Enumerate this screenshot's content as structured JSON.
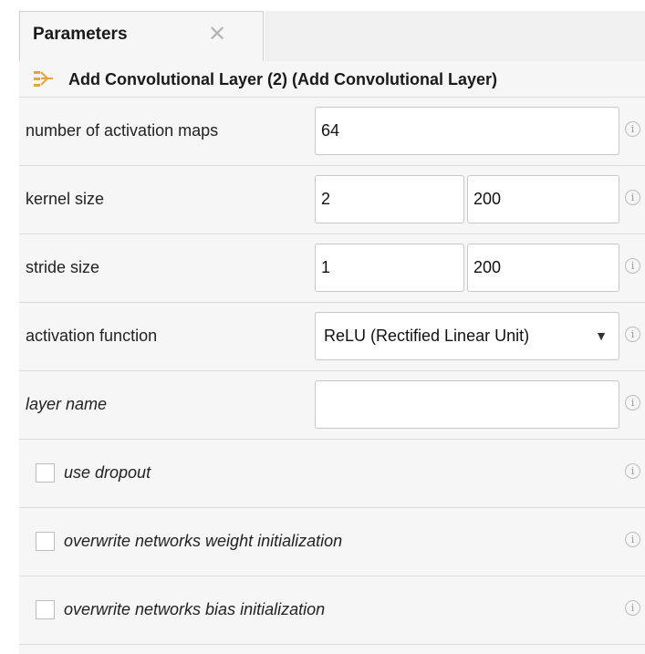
{
  "tab": {
    "title": "Parameters",
    "close_glyph": "✕"
  },
  "header": {
    "title": "Add Convolutional Layer (2) (Add Convolutional Layer)",
    "icon": "layer-flow-icon"
  },
  "fields": {
    "activation_maps": {
      "label": "number of activation maps",
      "value": "64"
    },
    "kernel_size": {
      "label": "kernel size",
      "value_1": "2",
      "value_2": "200"
    },
    "stride_size": {
      "label": "stride size",
      "value_1": "1",
      "value_2": "200"
    },
    "activation_function": {
      "label": "activation function",
      "selected": "ReLU (Rectified Linear Unit)"
    },
    "layer_name": {
      "label": "layer name",
      "value": ""
    }
  },
  "checkboxes": {
    "use_dropout": {
      "label": "use dropout",
      "checked": false
    },
    "weight_init": {
      "label": "overwrite networks weight initialization",
      "checked": false
    },
    "bias_init": {
      "label": "overwrite networks bias initialization",
      "checked": false
    }
  },
  "info_glyph": "i",
  "colors": {
    "icon_accent": "#e8a23c",
    "panel_bg": "#f6f6f6"
  }
}
